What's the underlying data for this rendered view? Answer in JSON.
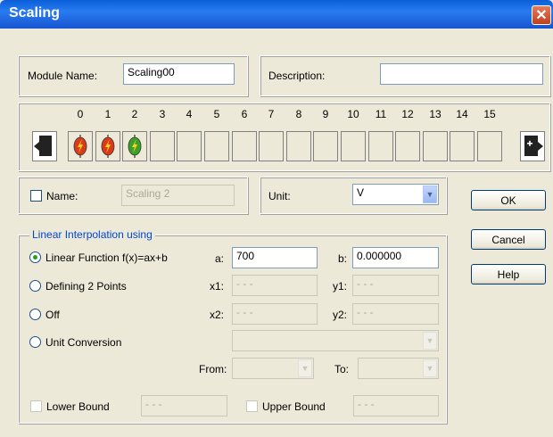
{
  "window": {
    "title": "Scaling",
    "close_glyph": "✕"
  },
  "module": {
    "name_label": "Module Name:",
    "name_value": "Scaling00",
    "description_label": "Description:",
    "description_value": ""
  },
  "channels": {
    "numbers": [
      "0",
      "1",
      "2",
      "3",
      "4",
      "5",
      "6",
      "7",
      "8",
      "9",
      "10",
      "11",
      "12",
      "13",
      "14",
      "15"
    ],
    "active_icons": [
      {
        "index": 0,
        "icon": "red-lightning-icon",
        "color": "#d83a1a"
      },
      {
        "index": 1,
        "icon": "red-lightning-icon",
        "color": "#d83a1a"
      },
      {
        "index": 2,
        "icon": "green-lightning-icon",
        "color": "#3aa02a"
      }
    ]
  },
  "name_row": {
    "name_label": "Name:",
    "name_value": "Scaling 2",
    "unit_label": "Unit:",
    "unit_value": "V"
  },
  "buttons": {
    "ok": "OK",
    "cancel": "Cancel",
    "help": "Help"
  },
  "interp": {
    "group_label": "Linear Interpolation using",
    "options": [
      "Linear Function f(x)=ax+b",
      "Defining 2 Points",
      "Off",
      "Unit Conversion"
    ],
    "selected": "Linear Function f(x)=ax+b",
    "a_label": "a:",
    "a_value": "700",
    "b_label": "b:",
    "b_value": "0.000000",
    "x1_label": "x1:",
    "x1_value": "- - -",
    "y1_label": "y1:",
    "y1_value": "- - -",
    "x2_label": "x2:",
    "x2_value": "- - -",
    "y2_label": "y2:",
    "y2_value": "- - -",
    "from_label": "From:",
    "to_label": "To:",
    "lower_label": "Lower Bound",
    "lower_value": "- - -",
    "upper_label": "Upper Bound",
    "upper_value": "- - -"
  }
}
